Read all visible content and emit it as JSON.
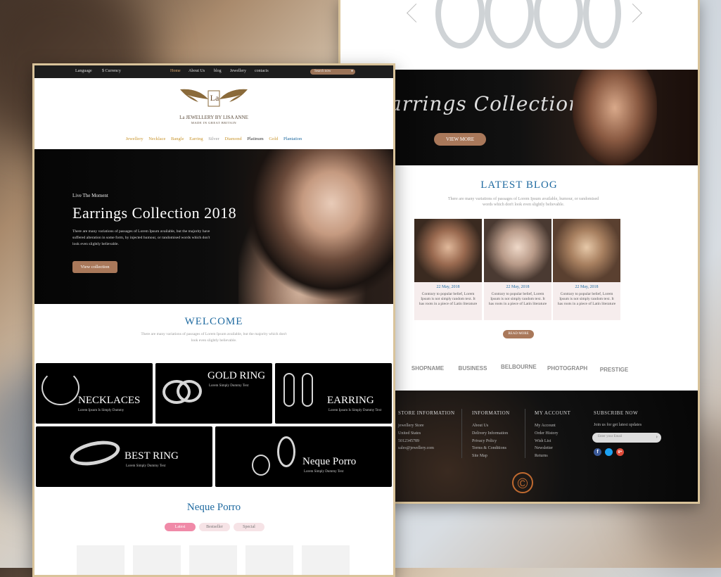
{
  "back": {
    "hero_title": "arrings Collection 2018",
    "view_more": "VIEW MORE",
    "blog_title": "LATEST BLOG",
    "blog_sub": "There are many variations of passages of Lorem Ipsum available, humour, or randomised words which don't look even slightly believable.",
    "read_more": "READ MORE",
    "cards": [
      {
        "date": "22 May, 2018",
        "text": "Contrary to popular belief, Lorem Ipsum is not simply random text. It has roots in a piece of Latin literature"
      },
      {
        "date": "22 May, 2018",
        "text": "Contrary to popular belief, Lorem Ipsum is not simply random text. It has roots in a piece of Latin literature"
      },
      {
        "date": "22 May, 2018",
        "text": "Contrary to popular belief, Lorem Ipsum is not simply random text. It has roots in a piece of Latin literature"
      }
    ],
    "logos": [
      "SHOPNAME",
      "BUSINESS",
      "BELBOURNE",
      "PHOTOGRAPH",
      "PRESTIGE"
    ],
    "footer": {
      "store_heading": "STORE INFORMATION",
      "store_lines": [
        "jewellery Store",
        "United States",
        "5012345789",
        "sales@jewellery.com"
      ],
      "info_heading": "INFORMATION",
      "info_links": [
        "About Us",
        "Delivery Information",
        "Privacy Policy",
        "Terms & Conditions",
        "Site Map"
      ],
      "account_heading": "MY ACCOUNT",
      "account_links": [
        "My Account",
        "Order History",
        "Wish List",
        "Newsletter",
        "Returns"
      ],
      "subscribe_heading": "SUBSCRIBE NOW",
      "subscribe_sub": "Join us for get latest updates",
      "email_placeholder": "Enter your Email",
      "copyright_symbol": "©"
    }
  },
  "front": {
    "topbar": {
      "language": "Language",
      "currency": "$ Currency",
      "nav": [
        "Home",
        "About Us",
        "blog",
        "Jewellery",
        "contacts"
      ],
      "search_placeholder": "Search now"
    },
    "logo_letters": "La",
    "brand": "La JEWELLERY BY LISA ANNE",
    "brand_sub": "MADE IN GREAT BRITAIN",
    "categories": [
      {
        "label": "Jewellery",
        "color": "#c9962f"
      },
      {
        "label": "Necklace",
        "color": "#c9962f"
      },
      {
        "label": "Bangle",
        "color": "#c9962f"
      },
      {
        "label": "Earring",
        "color": "#c9962f"
      },
      {
        "label": "Silver",
        "color": "#9a9a9a"
      },
      {
        "label": "Diamond",
        "color": "#c9962f"
      },
      {
        "label": "Platinum",
        "color": "#333333"
      },
      {
        "label": "Gold",
        "color": "#c9962f"
      },
      {
        "label": "Plantation",
        "color": "#1f6aa0"
      }
    ],
    "hero": {
      "kicker": "Live The Moment",
      "title": "Earrings Collection 2018",
      "text": "There are many variations of passages of Lorem Ipsum available, but the majority have suffered alteration in some form, by injected humour, or randomised words which don't look even slightly believable.",
      "button": "View collection"
    },
    "welcome": "WELCOME",
    "welcome_sub": "There are many variations of passages of Lorem Ipsum available, but the majority which don't look even slightly believable.",
    "tiles": [
      {
        "name": "NECKLACES",
        "sub": "Lorem Ipsum Is Simply Dummy"
      },
      {
        "name": "GOLD RING",
        "sub": "Lorem Simply Dummy Text"
      },
      {
        "name": "EARRING",
        "sub": "Lorem Ipsum Is Simply Dummy Text"
      },
      {
        "name": "BEST RING",
        "sub": "Lorem Simply Dummy Text"
      },
      {
        "name": "Neque Porro",
        "sub": "Lorem Simply Dummy Text"
      }
    ],
    "section_title": "Neque Porro",
    "tabs": [
      "Latest",
      "Bestseller",
      "Special"
    ]
  },
  "colors": {
    "accent_blue": "#1f6aa0",
    "brown": "#a9785a",
    "gold": "#c9962f",
    "pink": "#f08aa8"
  }
}
